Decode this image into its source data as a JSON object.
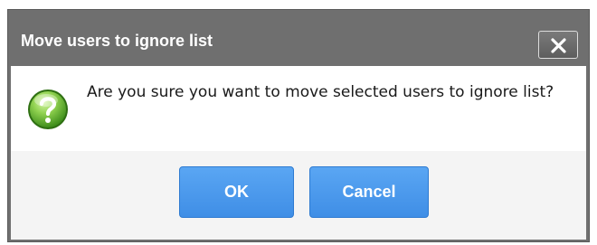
{
  "dialog": {
    "title": "Move users to ignore list",
    "close_icon": "close-x-icon",
    "message_icon": "question-mark-icon",
    "message": "Are you sure you want to move selected users to ignore list?",
    "buttons": {
      "ok_label": "OK",
      "cancel_label": "Cancel"
    }
  },
  "colors": {
    "titlebar": "#6f6f6f",
    "button_primary": "#4a9aec",
    "icon_green": "#8fd14f"
  }
}
